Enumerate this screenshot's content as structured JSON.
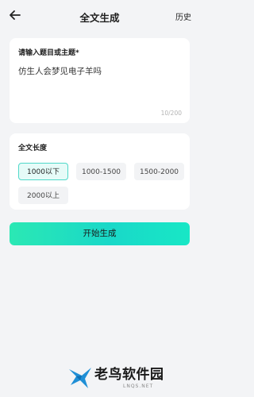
{
  "header": {
    "title": "全文生成",
    "history_label": "历史"
  },
  "topic": {
    "label": "请输入题目或主题*",
    "value": "仿生人会梦见电子羊吗",
    "counter": "10/200"
  },
  "length": {
    "label": "全文长度",
    "options": [
      {
        "label": "1000以下",
        "selected": true
      },
      {
        "label": "1000-1500",
        "selected": false
      },
      {
        "label": "1500-2000",
        "selected": false
      },
      {
        "label": "2000以上",
        "selected": false
      }
    ]
  },
  "actions": {
    "generate_label": "开始生成"
  },
  "watermark": {
    "name": "老鸟软件园",
    "url": "LNQS.NET"
  },
  "colors": {
    "accent": "#1fdcc3",
    "selected_border": "#4fd8c9",
    "background": "#f3f4f6"
  }
}
